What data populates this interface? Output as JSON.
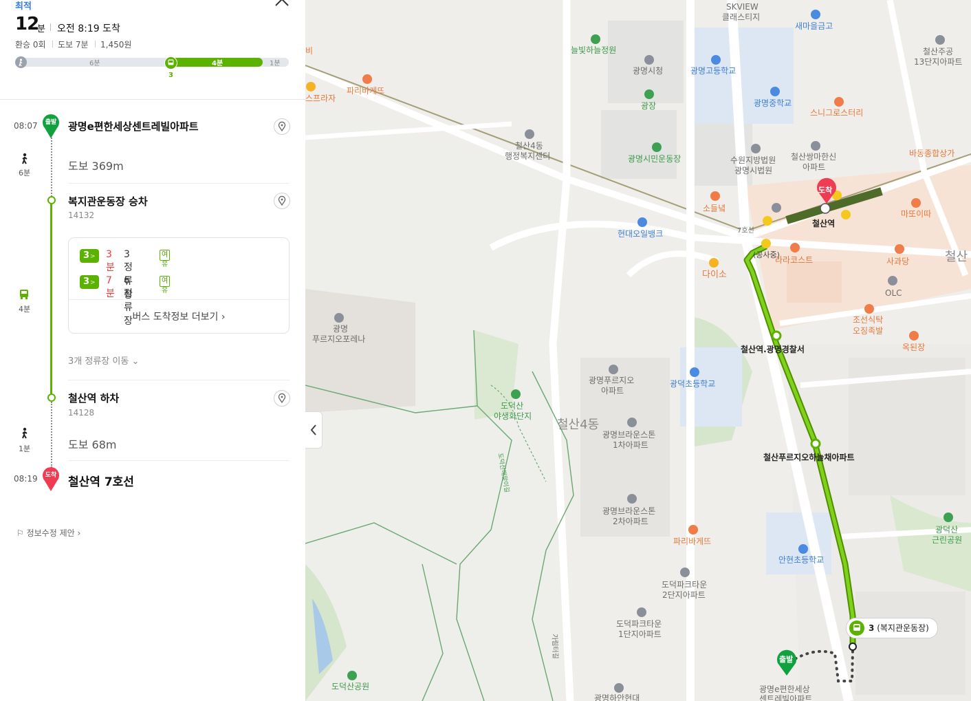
{
  "summary": {
    "badge": "최적",
    "minutes": "12",
    "minutes_unit": "분",
    "arrival": "오전 8:19 도착",
    "transfers": "환승 0회",
    "walk": "도보 7분",
    "fare": "1,450원"
  },
  "progress": {
    "walk1_label": "6분",
    "bus_label": "4분",
    "walk2_label": "1분",
    "bus_number": "3",
    "bus_share": 0.33
  },
  "itinerary": {
    "start": {
      "time": "08:07",
      "badge": "출발",
      "name": "광명e편한세상센트레빌아파트"
    },
    "walk1": {
      "minutes": "6분",
      "text": "도보 369m"
    },
    "board": {
      "name": "복지관운동장 승차",
      "id": "14132"
    },
    "buses": [
      {
        "number": "3",
        "wait": "3분",
        "stops": "3정류장",
        "status": "여유"
      },
      {
        "number": "3",
        "wait": "7분",
        "stops": "6정류장",
        "status": "여유"
      }
    ],
    "bus_more": "버스 도착정보 더보기",
    "bus_minutes": "4분",
    "move": "3개 정류장 이동",
    "alight": {
      "name": "철산역 하차",
      "id": "14128"
    },
    "walk2": {
      "minutes": "1분",
      "text": "도보 68m"
    },
    "end": {
      "time": "08:19",
      "badge": "도착",
      "name": "철산역 7호선"
    }
  },
  "edit_link": "정보수정 제안",
  "map": {
    "labels": {
      "skview": "SKVIEW",
      "classtage": "클래스티지",
      "saemaeul": "새마을금고",
      "cheolsan13": "철산주공",
      "cheolsan13b": "13단지아파트",
      "neulbit": "늘빛하늘정원",
      "cityhall": "광명시청",
      "highschool": "광명고등학교",
      "paris1": "파리바게뜨",
      "plaza": "스프라자",
      "bi": "비",
      "square": "광장",
      "middle": "광명중학교",
      "snigro": "스니그로스터리",
      "bado": "바동종합상가",
      "admin1": "철산4동",
      "admin2": "행정복지센터",
      "stadium": "광명시민운동장",
      "court1": "수원지방법원",
      "court2": "광명시법원",
      "ssangma1": "철산쌍마한신",
      "ssangma2": "아파트",
      "sodeul": "소들녘",
      "hyundai": "현대오일뱅크",
      "line7": "7호선",
      "station": "철산역",
      "arrive": "도착",
      "mattoitta": "마또이따",
      "construction": "(공사중)",
      "lara": "라라코스트",
      "sagwadang": "사과당",
      "daiso": "다이소",
      "olc": "OLC",
      "cheolsan_edge": "철산",
      "joseon1": "조선식탁",
      "joseon2": "오징족발",
      "okdoen": "옥된장",
      "police": "철산역.광명경찰서",
      "prugio1": "광명",
      "prugio2": "푸르지오포레나",
      "dongdeok1": "광명푸르지오",
      "dongdeok2": "아파트",
      "gwangdeok_es": "광덕초등학교",
      "dodeoksan1": "도덕산",
      "dodeoksan2": "야생화단지",
      "cheolsan4": "철산4동",
      "brownstone1a": "광명브라운스톤",
      "brownstone1b": "1차아파트",
      "haneulchae": "철산푸르지오하늘채아파트",
      "brownstone2a": "광명브라운스톤",
      "brownstone2b": "2차아파트",
      "paris2": "파리바게뜨",
      "gwangdeok_park1": "광덕산",
      "gwangdeok_park2": "근린공원",
      "anhyeon": "안현초등학교",
      "park_town2a": "도덕파크타운",
      "park_town2b": "2단지아파트",
      "park_town1a": "도덕파크타운",
      "park_town1b": "1단지아파트",
      "bus_chip_num": "3",
      "bus_chip_name": "(복지관운동장)",
      "start_pin": "출발",
      "start_place1": "광명e편한세상",
      "start_place2": "센트레빌아파트",
      "dodeok_park": "도덕산공원",
      "bottom_cut": "광명하안현대",
      "gaeul": "가림터길",
      "trail": "도덕산해맞이길"
    }
  }
}
